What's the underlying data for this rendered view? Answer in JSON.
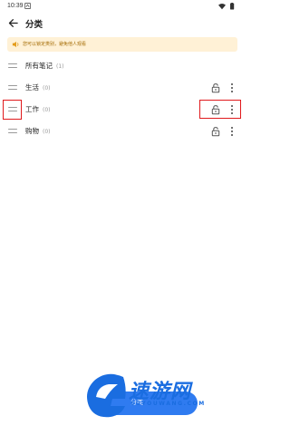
{
  "status_bar": {
    "time": "10:39"
  },
  "header": {
    "title": "分类"
  },
  "tip": {
    "text": "您可以锁定类别，避免他人观看"
  },
  "categories": [
    {
      "name": "所有笔记",
      "count": "(1)"
    },
    {
      "name": "生活",
      "count": "(0)"
    },
    {
      "name": "工作",
      "count": "(0)"
    },
    {
      "name": "购物",
      "count": "(0)"
    }
  ],
  "bottom_button": {
    "label": "分类"
  },
  "watermark": {
    "title": "速游网",
    "subtitle": "SUYOUWANG.COM"
  },
  "colors": {
    "accent": "#2f7bf0",
    "tip_background": "#fff1d6",
    "tip_text": "#a36a00",
    "highlight": "#e0191c",
    "watermark": "#1a6de0"
  }
}
